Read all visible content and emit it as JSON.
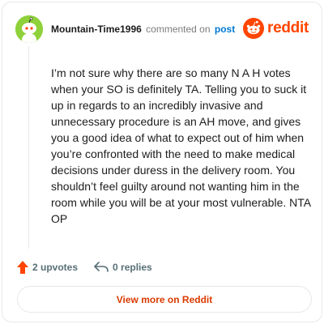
{
  "comment": {
    "username": "Mountain-Time1996",
    "commented_text": "commented on",
    "post_link": "post",
    "body": "I’m not sure why there are so many N A H votes when your SO is definitely TA. Telling you to suck it up in regards to an incredibly invasive and unnecessary procedure is an AH move, and gives you a good idea of what to expect out of him when you’re confronted with the need to make medical decisions under duress in the delivery room. You shouldn’t feel guilty around not wanting him in the room while you will be at your most vulnerable. NTA OP"
  },
  "brand": {
    "name": "reddit",
    "logo_icon": "reddit-snoo-icon",
    "color": "#ff4500"
  },
  "avatar": {
    "icon": "snoo-avatar-icon",
    "color": "#8ed13b"
  },
  "actions": {
    "upvotes_label": "2 upvotes",
    "upvote_icon": "upvote-arrow-icon",
    "replies_label": "0 replies",
    "reply_icon": "reply-arrow-icon"
  },
  "footer": {
    "view_more_label": "View more on Reddit"
  },
  "colors": {
    "link": "#0079d3",
    "upvote": "#ff4500",
    "button_text": "#d93a00"
  }
}
